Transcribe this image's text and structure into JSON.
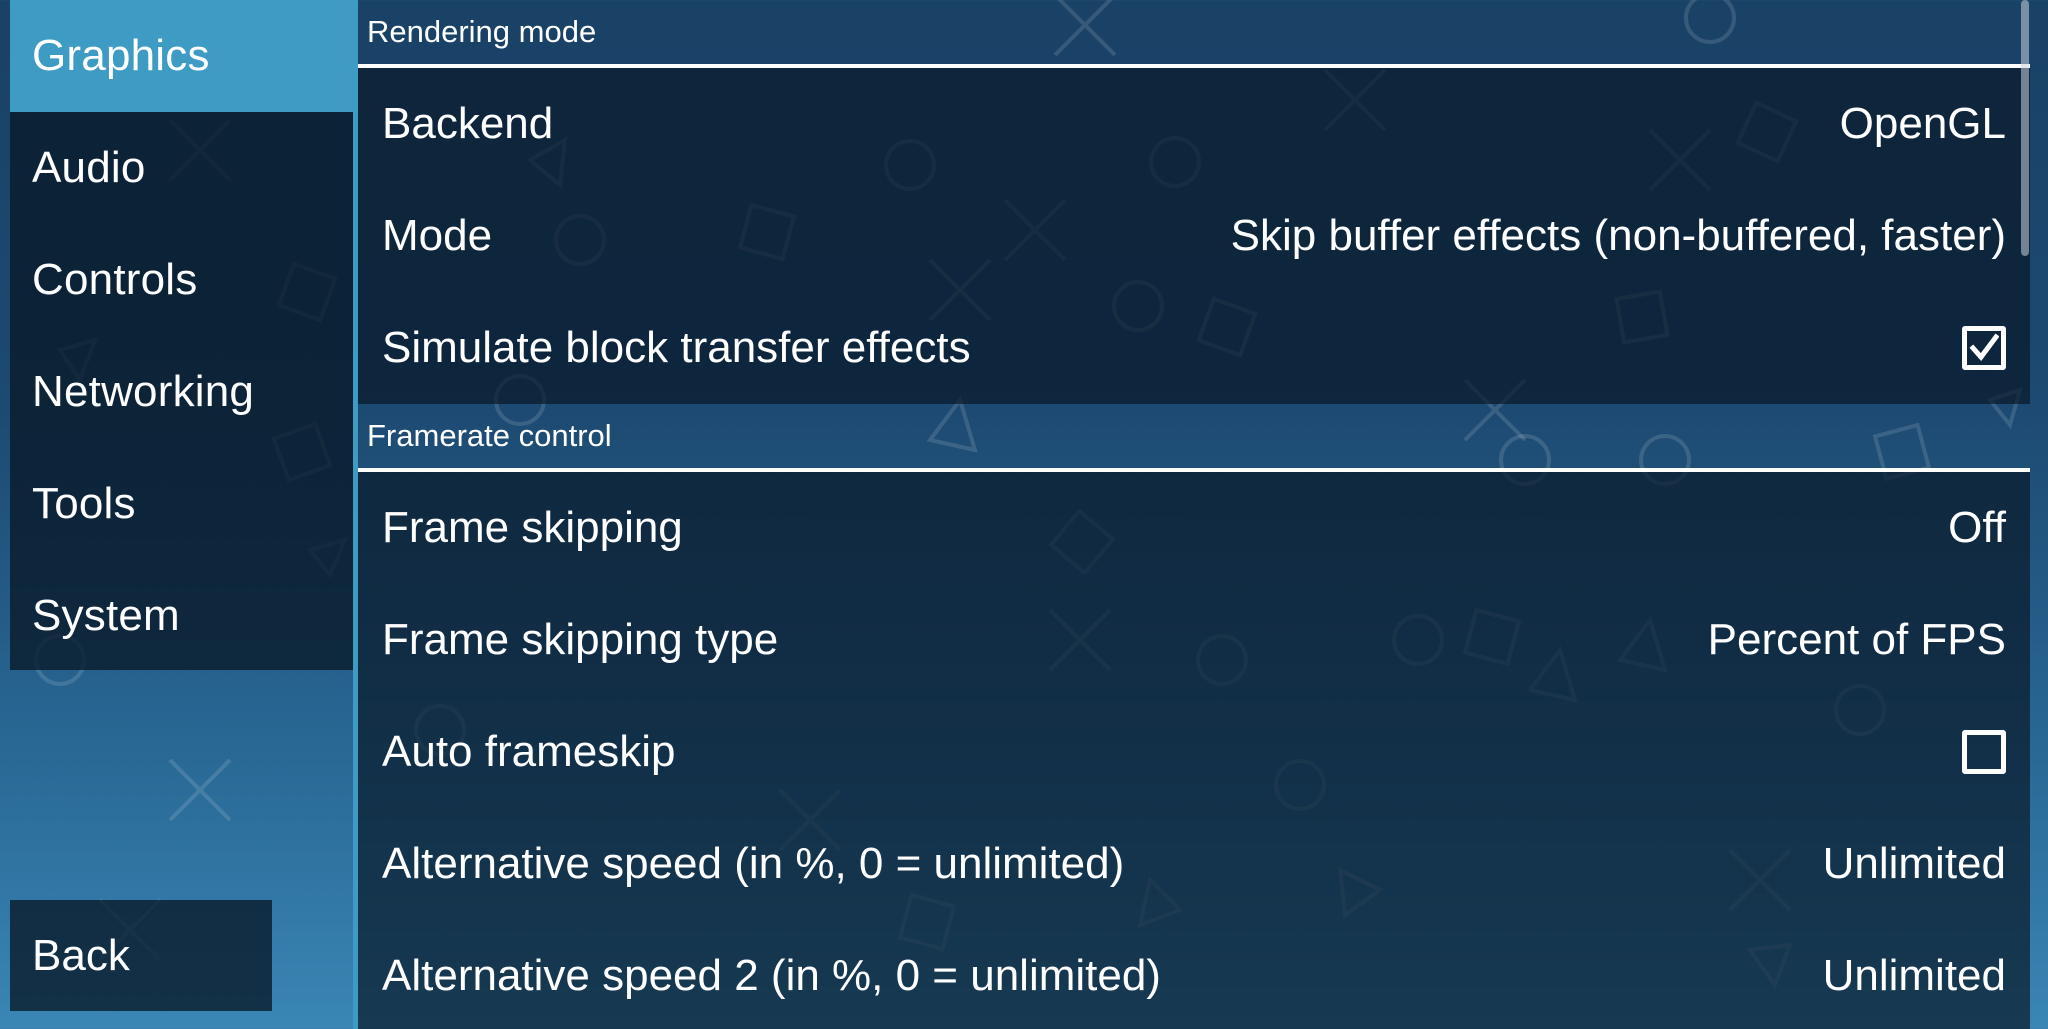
{
  "sidebar": {
    "tabs": [
      {
        "label": "Graphics",
        "active": true
      },
      {
        "label": "Audio",
        "active": false
      },
      {
        "label": "Controls",
        "active": false
      },
      {
        "label": "Networking",
        "active": false
      },
      {
        "label": "Tools",
        "active": false
      },
      {
        "label": "System",
        "active": false
      }
    ],
    "back_label": "Back"
  },
  "sections": {
    "rendering": {
      "title": "Rendering mode",
      "backend": {
        "label": "Backend",
        "value": "OpenGL"
      },
      "mode": {
        "label": "Mode",
        "value": "Skip buffer effects (non-buffered, faster)"
      },
      "block_transfer": {
        "label": "Simulate block transfer effects",
        "checked": true
      }
    },
    "framerate": {
      "title": "Framerate control",
      "frame_skipping": {
        "label": "Frame skipping",
        "value": "Off"
      },
      "frame_skipping_type": {
        "label": "Frame skipping type",
        "value": "Percent of FPS"
      },
      "auto_frameskip": {
        "label": "Auto frameskip",
        "checked": false
      },
      "alt_speed": {
        "label": "Alternative speed (in %, 0 = unlimited)",
        "value": "Unlimited"
      },
      "alt_speed_2": {
        "label": "Alternative speed 2 (in %, 0 = unlimited)",
        "value": "Unlimited"
      }
    }
  },
  "icons": {
    "checkbox_checked": "checkbox-checked-icon",
    "checkbox_unchecked": "checkbox-unchecked-icon",
    "background_shapes": [
      "circle",
      "cross",
      "square",
      "triangle"
    ]
  },
  "colors": {
    "accent": "#3d9bc4",
    "panel": "#081828",
    "text": "#ffffff"
  }
}
